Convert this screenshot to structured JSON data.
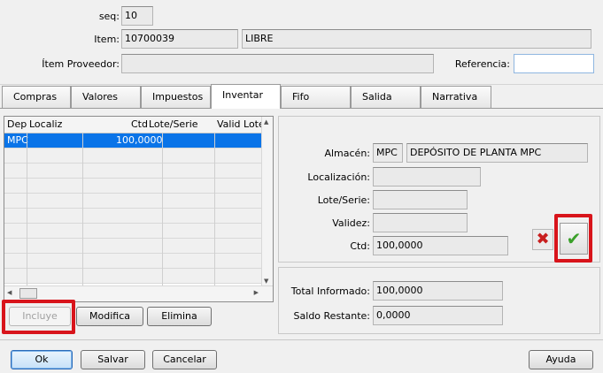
{
  "header": {
    "seq_label": "seq:",
    "seq_value": "10",
    "item_label": "Item:",
    "item_code": "10700039",
    "item_desc": "LIBRE",
    "supplier_item_label": "Ítem Proveedor:",
    "supplier_item_value": "",
    "reference_label": "Referencia:",
    "reference_value": ""
  },
  "tabs": [
    {
      "label": "Compras",
      "active": false
    },
    {
      "label": "Valores",
      "active": false
    },
    {
      "label": "Impuestos",
      "active": false
    },
    {
      "label": "Inventar",
      "active": true
    },
    {
      "label": "Fifo",
      "active": false
    },
    {
      "label": "Salida",
      "active": false
    },
    {
      "label": "Narrativa",
      "active": false
    }
  ],
  "grid": {
    "columns": [
      "Dep",
      "Localiz",
      "Ctd",
      "Lote/Serie",
      "Valid Lote"
    ],
    "rows": [
      {
        "dep": "MPC",
        "localiz": "",
        "ctd": "100,0000",
        "lote": "",
        "valid": ""
      }
    ]
  },
  "grid_buttons": {
    "include": "Incluye",
    "modify": "Modifica",
    "delete": "Elimina"
  },
  "detail": {
    "warehouse_label": "Almacén:",
    "warehouse_code": "MPC",
    "warehouse_name": "DEPÓSITO DE PLANTA MPC",
    "location_label": "Localización:",
    "location_value": "",
    "lot_label": "Lote/Serie:",
    "lot_value": "",
    "validity_label": "Validez:",
    "validity_value": "",
    "qty_label": "Ctd:",
    "qty_value": "100,0000"
  },
  "totals": {
    "total_label": "Total Informado:",
    "total_value": "100,0000",
    "balance_label": "Saldo Restante:",
    "balance_value": "0,0000"
  },
  "footer": {
    "ok": "Ok",
    "save": "Salvar",
    "cancel": "Cancelar",
    "help": "Ayuda"
  },
  "colors": {
    "selection": "#0a74e8",
    "highlight": "#d8141b",
    "confirm_check": "#3aa02a",
    "cancel_x": "#c81e1e"
  }
}
